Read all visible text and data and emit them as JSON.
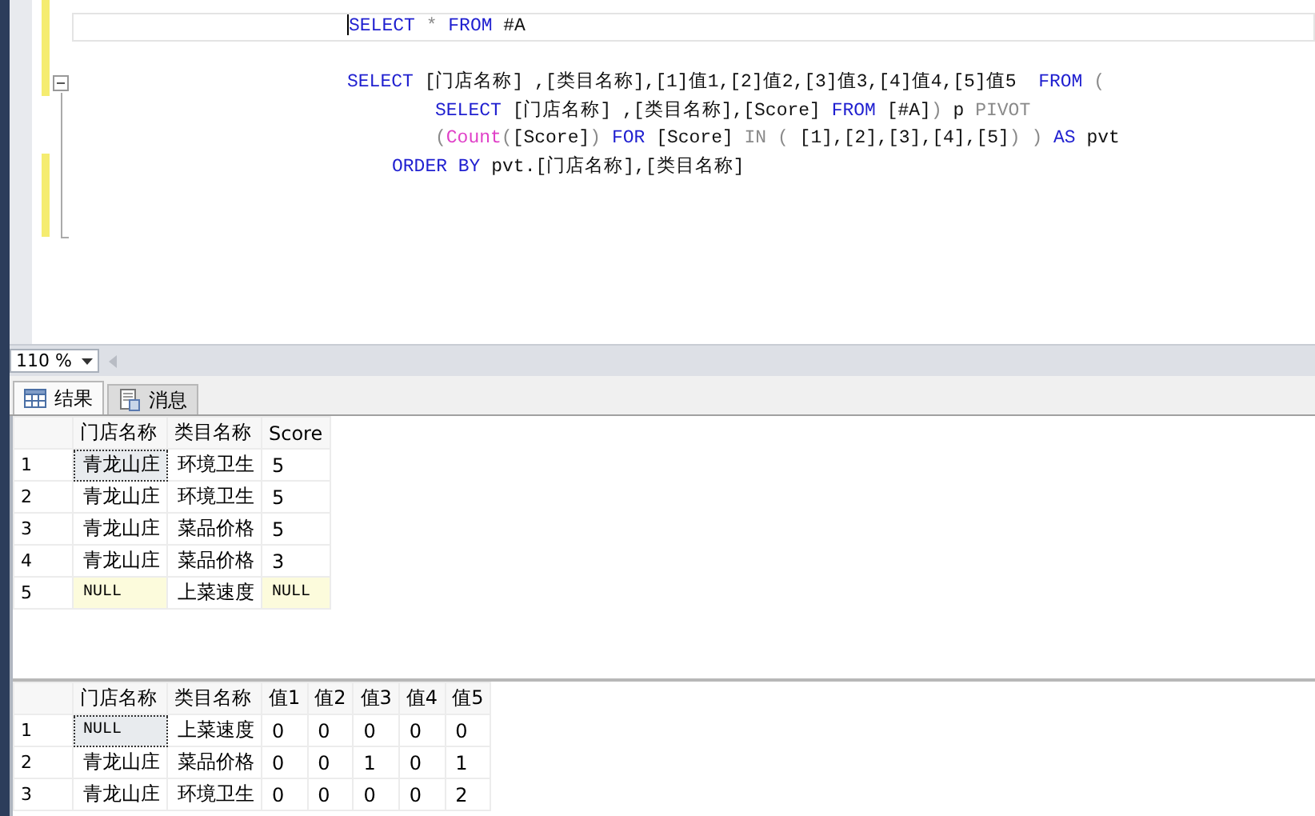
{
  "editor": {
    "lines": [
      {
        "kind": "statement",
        "current": true,
        "tokens": [
          {
            "kind": "keyword",
            "text": "SELECT"
          },
          {
            "kind": "operator",
            "text": " * "
          },
          {
            "kind": "keyword",
            "text": "FROM"
          },
          {
            "kind": "plain",
            "text": " #A"
          }
        ]
      },
      {
        "kind": "blank",
        "current": false
      },
      {
        "kind": "statement",
        "current": false,
        "tokens": [
          {
            "kind": "keyword",
            "text": "SELECT"
          },
          {
            "kind": "plain",
            "text": " [门店名称] ,[类目名称],[1]值1,[2]值2,[3]值3,[4]值4,[5]值5  "
          },
          {
            "kind": "keyword",
            "text": "FROM"
          },
          {
            "kind": "operator",
            "text": " ("
          }
        ]
      },
      {
        "kind": "nested",
        "current": false,
        "tokens": [
          {
            "kind": "keyword",
            "text": "SELECT"
          },
          {
            "kind": "plain",
            "text": " [门店名称] ,[类目名称],[Score] "
          },
          {
            "kind": "keyword",
            "text": "FROM"
          },
          {
            "kind": "plain",
            "text": " [#A]"
          },
          {
            "kind": "operator",
            "text": ")"
          },
          {
            "kind": "plain",
            "text": " p "
          },
          {
            "kind": "operator",
            "text": "PIVOT"
          }
        ]
      },
      {
        "kind": "nested",
        "current": false,
        "tokens": [
          {
            "kind": "operator",
            "text": "("
          },
          {
            "kind": "function",
            "text": "Count"
          },
          {
            "kind": "operator",
            "text": "("
          },
          {
            "kind": "plain",
            "text": "[Score]"
          },
          {
            "kind": "operator",
            "text": ")"
          },
          {
            "kind": "keyword",
            "text": " FOR "
          },
          {
            "kind": "plain",
            "text": "[Score] "
          },
          {
            "kind": "operator",
            "text": "IN ( "
          },
          {
            "kind": "plain",
            "text": "[1],[2],[3],[4],[5]"
          },
          {
            "kind": "operator",
            "text": ") ) "
          },
          {
            "kind": "keyword",
            "text": "AS"
          },
          {
            "kind": "plain",
            "text": " pvt"
          }
        ]
      },
      {
        "kind": "clause",
        "current": false,
        "tokens": [
          {
            "kind": "keyword",
            "text": "ORDER BY"
          },
          {
            "kind": "plain",
            "text": " pvt.[门店名称],[类目名称]"
          }
        ]
      }
    ]
  },
  "zoom": {
    "value": "110 %"
  },
  "tabs": [
    {
      "label": "结果",
      "kind": "grid",
      "selected": true
    },
    {
      "label": "消息",
      "kind": "messages",
      "selected": false
    }
  ],
  "grids": [
    {
      "columns": [
        "门店名称",
        "类目名称",
        "Score"
      ],
      "rows": [
        {
          "number": "1",
          "cells": [
            {
              "text": "青龙山庄",
              "null": false,
              "focused": true
            },
            {
              "text": "环境卫生",
              "null": false,
              "focused": false
            },
            {
              "text": "5",
              "null": false,
              "focused": false
            }
          ]
        },
        {
          "number": "2",
          "cells": [
            {
              "text": "青龙山庄",
              "null": false,
              "focused": false
            },
            {
              "text": "环境卫生",
              "null": false,
              "focused": false
            },
            {
              "text": "5",
              "null": false,
              "focused": false
            }
          ]
        },
        {
          "number": "3",
          "cells": [
            {
              "text": "青龙山庄",
              "null": false,
              "focused": false
            },
            {
              "text": "菜品价格",
              "null": false,
              "focused": false
            },
            {
              "text": "5",
              "null": false,
              "focused": false
            }
          ]
        },
        {
          "number": "4",
          "cells": [
            {
              "text": "青龙山庄",
              "null": false,
              "focused": false
            },
            {
              "text": "菜品价格",
              "null": false,
              "focused": false
            },
            {
              "text": "3",
              "null": false,
              "focused": false
            }
          ]
        },
        {
          "number": "5",
          "cells": [
            {
              "text": "NULL",
              "null": true,
              "focused": false
            },
            {
              "text": "上菜速度",
              "null": false,
              "focused": false
            },
            {
              "text": "NULL",
              "null": true,
              "focused": false
            }
          ]
        }
      ]
    },
    {
      "columns": [
        "门店名称",
        "类目名称",
        "值1",
        "值2",
        "值3",
        "值4",
        "值5"
      ],
      "rows": [
        {
          "number": "1",
          "cells": [
            {
              "text": "NULL",
              "null": true,
              "focused": true
            },
            {
              "text": "上菜速度",
              "null": false,
              "focused": false
            },
            {
              "text": "0",
              "null": false,
              "focused": false
            },
            {
              "text": "0",
              "null": false,
              "focused": false
            },
            {
              "text": "0",
              "null": false,
              "focused": false
            },
            {
              "text": "0",
              "null": false,
              "focused": false
            },
            {
              "text": "0",
              "null": false,
              "focused": false
            }
          ]
        },
        {
          "number": "2",
          "cells": [
            {
              "text": "青龙山庄",
              "null": false,
              "focused": false
            },
            {
              "text": "菜品价格",
              "null": false,
              "focused": false
            },
            {
              "text": "0",
              "null": false,
              "focused": false
            },
            {
              "text": "0",
              "null": false,
              "focused": false
            },
            {
              "text": "1",
              "null": false,
              "focused": false
            },
            {
              "text": "0",
              "null": false,
              "focused": false
            },
            {
              "text": "1",
              "null": false,
              "focused": false
            }
          ]
        },
        {
          "number": "3",
          "cells": [
            {
              "text": "青龙山庄",
              "null": false,
              "focused": false
            },
            {
              "text": "环境卫生",
              "null": false,
              "focused": false
            },
            {
              "text": "0",
              "null": false,
              "focused": false
            },
            {
              "text": "0",
              "null": false,
              "focused": false
            },
            {
              "text": "0",
              "null": false,
              "focused": false
            },
            {
              "text": "0",
              "null": false,
              "focused": false
            },
            {
              "text": "2",
              "null": false,
              "focused": false
            }
          ]
        }
      ]
    }
  ]
}
